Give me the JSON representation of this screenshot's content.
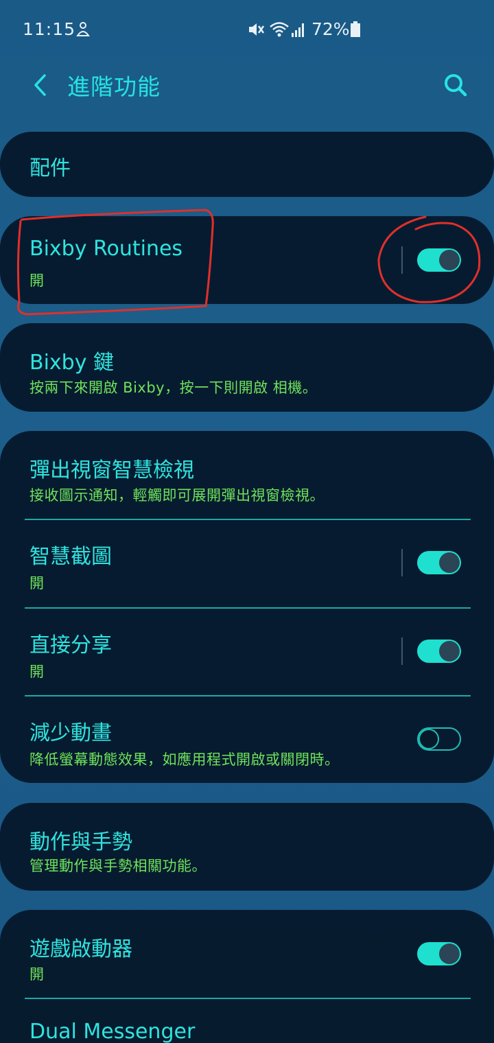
{
  "status_bar": {
    "time": "11:15",
    "battery": "72%",
    "icons": [
      "notification-icon",
      "mute-icon",
      "wifi-icon",
      "signal-icon",
      "battery-icon"
    ]
  },
  "header": {
    "title": "進階功能",
    "back_icon": "chevron-left-icon",
    "search_icon": "search-icon"
  },
  "items": {
    "accessories": {
      "title": "配件"
    },
    "bixby_routines": {
      "title": "Bixby Routines",
      "sub": "開",
      "toggle": true
    },
    "bixby_key": {
      "title": "Bixby 鍵",
      "sub": "按兩下來開啟 Bixby，按一下則開啟 相機。"
    },
    "smart_popup": {
      "title": "彈出視窗智慧檢視",
      "sub": "接收圖示通知，輕觸即可展開彈出視窗檢視。"
    },
    "smart_capture": {
      "title": "智慧截圖",
      "sub": "開",
      "toggle": true
    },
    "direct_share": {
      "title": "直接分享",
      "sub": "開",
      "toggle": true
    },
    "reduce_anim": {
      "title": "減少動畫",
      "sub": "降低螢幕動態效果，如應用程式開啟或關閉時。",
      "toggle": false
    },
    "motions": {
      "title": "動作與手勢",
      "sub": "管理動作與手勢相關功能。"
    },
    "game_launcher": {
      "title": "遊戲啟動器",
      "sub": "開",
      "toggle": true
    },
    "dual_messenger": {
      "title": "Dual Messenger"
    }
  },
  "colors": {
    "accent": "#27e3e0",
    "subtitle": "#6fe35a",
    "annotation": "#e0302a"
  }
}
